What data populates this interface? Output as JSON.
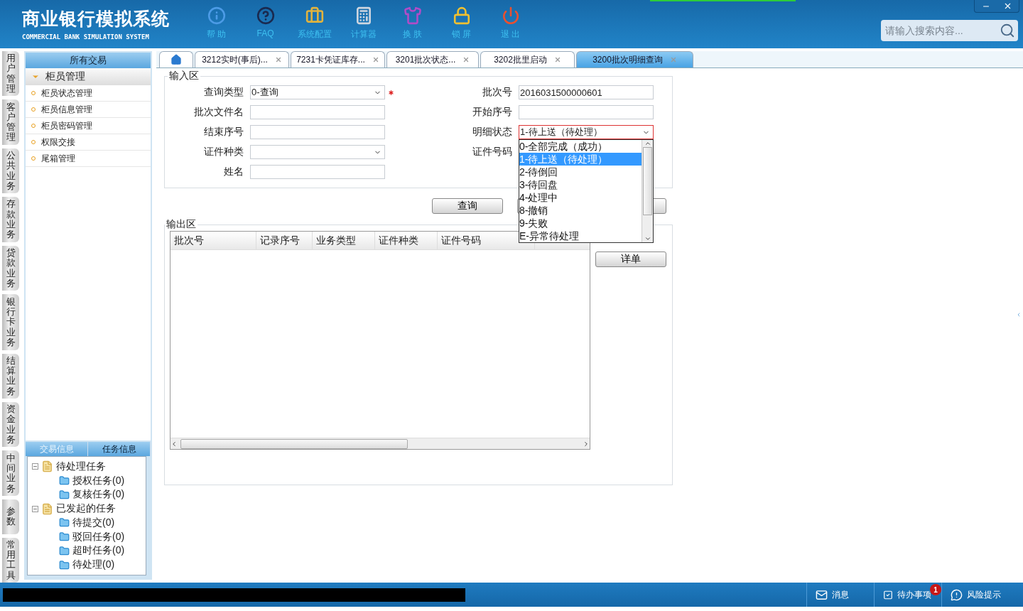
{
  "header": {
    "title": "商业银行模拟系统",
    "subtitle": "COMMERCIAL BANK SIMULATION SYSTEM",
    "toolbar": [
      {
        "label": "帮 助",
        "kind": "info"
      },
      {
        "label": "FAQ",
        "kind": "help"
      },
      {
        "label": "系统配置",
        "kind": "toolbox"
      },
      {
        "label": "计算器",
        "kind": "calculator"
      },
      {
        "label": "换 肤",
        "kind": "shirt"
      },
      {
        "label": "锁 屏",
        "kind": "lock"
      },
      {
        "label": "退 出",
        "kind": "power"
      }
    ],
    "search": {
      "placeholder": "请输入搜索内容..."
    }
  },
  "side_nav": [
    "用户管理",
    "客户管理",
    "公共业务",
    "存款业务",
    "贷款业务",
    "银行卡业务",
    "结算业务",
    "资金业务",
    "中间业务",
    "参数",
    "常用工具"
  ],
  "sidebar": {
    "heading": "所有交易",
    "group": {
      "label": "柜员管理",
      "expanded": true,
      "items": [
        "柜员状态管理",
        "柜员信息管理",
        "柜员密码管理",
        "权限交接",
        "尾箱管理"
      ]
    },
    "panel_tabs": [
      {
        "label": "交易信息",
        "selected": false
      },
      {
        "label": "任务信息",
        "selected": true
      }
    ],
    "tree": [
      {
        "label": "待处理任务",
        "expanded": true,
        "children": [
          {
            "label": "授权任务(0)"
          },
          {
            "label": "复核任务(0)"
          }
        ]
      },
      {
        "label": "已发起的任务",
        "expanded": true,
        "children": [
          {
            "label": "待提交(0)"
          },
          {
            "label": "驳回任务(0)"
          },
          {
            "label": "超时任务(0)"
          },
          {
            "label": "待处理(0)"
          }
        ]
      }
    ]
  },
  "tabs": [
    {
      "kind": "home",
      "selected": false
    },
    {
      "kind": "text",
      "label": "3212实时(事后)...",
      "selected": false
    },
    {
      "kind": "text",
      "label": "7231卡凭证库存...",
      "selected": false
    },
    {
      "kind": "text",
      "label": "3201批次状态...",
      "selected": false
    },
    {
      "kind": "text",
      "label": "3202批里启动",
      "selected": false
    },
    {
      "kind": "text",
      "label": "3200批次明细查询",
      "selected": true
    }
  ],
  "input_area": {
    "legend": "输入区",
    "left_fields": [
      {
        "label": "查询类型",
        "kind": "select",
        "value": "0-查询",
        "required": true
      },
      {
        "label": "批次文件名",
        "kind": "text"
      },
      {
        "label": "结束序号",
        "kind": "text"
      },
      {
        "label": "证件种类",
        "kind": "select"
      },
      {
        "label": "姓名",
        "kind": "text"
      }
    ],
    "right_fields": [
      {
        "label": "批次号",
        "kind": "text",
        "value": "2016031500000601"
      },
      {
        "label": "开始序号",
        "kind": "text"
      },
      {
        "label": "明细状态",
        "kind": "select",
        "value": "1-待上送（待处理）",
        "focused": true,
        "open": true,
        "options": [
          {
            "label": "0-全部完成（成功）",
            "selected": false
          },
          {
            "label": "1-待上送（待处理）",
            "selected": true
          },
          {
            "label": "2-待倒回",
            "selected": false
          },
          {
            "label": "3-待回盘",
            "selected": false
          },
          {
            "label": "4-处理中",
            "selected": false
          },
          {
            "label": "8-撤销",
            "selected": false
          },
          {
            "label": "9-失败",
            "selected": false
          },
          {
            "label": "E-异常待处理",
            "selected": false
          }
        ]
      },
      {
        "label": "证件号码",
        "kind": "covered"
      }
    ],
    "buttons": [
      {
        "label": "查询"
      },
      {
        "kind": "blank"
      },
      {
        "kind": "blank"
      }
    ]
  },
  "output_area": {
    "legend": "输出区",
    "columns": [
      "批次号",
      "记录序号",
      "业务类型",
      "证件种类",
      "证件号码"
    ],
    "detail_button": "详单"
  },
  "status_bar": [
    {
      "label": "消息",
      "kind": "mail"
    },
    {
      "label": "待办事项",
      "kind": "check",
      "badge": "1"
    },
    {
      "label": "风险提示",
      "kind": "alert"
    }
  ]
}
